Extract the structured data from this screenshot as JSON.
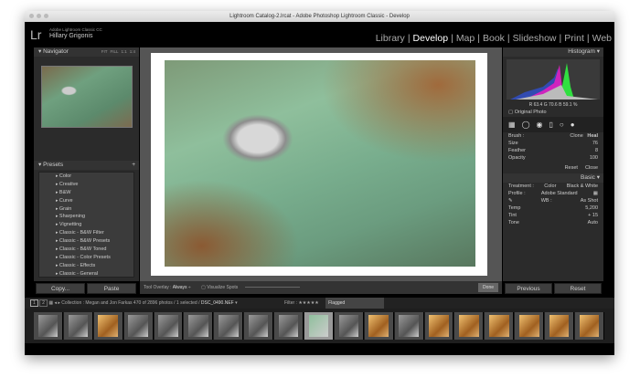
{
  "window": {
    "title": "Lightroom Catalog-2.lrcat - Adobe Photoshop Lightroom Classic - Develop"
  },
  "identity": {
    "logo": "Lr",
    "app": "Adobe Lightroom Classic CC",
    "user": "Hillary Grigonis"
  },
  "modules": [
    "Library",
    "Develop",
    "Map",
    "Book",
    "Slideshow",
    "Print",
    "Web"
  ],
  "active_module": "Develop",
  "navigator": {
    "title": "Navigator",
    "zoom": [
      "FIT",
      "FILL",
      "1:1",
      "1:4"
    ]
  },
  "presets": {
    "title": "Presets",
    "items": [
      "Color",
      "Creative",
      "B&W",
      "Curve",
      "Grain",
      "Sharpening",
      "Vignetting",
      "Classic - B&W Filter",
      "Classic - B&W Presets",
      "Classic - B&W Toned",
      "Classic - Color Presets",
      "Classic - Effects",
      "Classic - General"
    ]
  },
  "left_buttons": {
    "copy": "Copy...",
    "paste": "Paste"
  },
  "toolbar": {
    "tool_overlay_label": "Tool Overlay :",
    "tool_overlay_value": "Always",
    "visualize": "Visualize Spots",
    "done": "Done"
  },
  "histogram": {
    "title": "Histogram",
    "r": "63.4",
    "g": "70.6",
    "b": "59.1",
    "pct": "%",
    "original": "Original Photo"
  },
  "brush": {
    "label": "Brush :",
    "clone": "Clone",
    "heal": "Heal",
    "size_label": "Size",
    "size": "76",
    "feather_label": "Feather",
    "feather": "8",
    "opacity_label": "Opacity",
    "opacity": "100",
    "reset": "Reset",
    "close": "Close"
  },
  "basic": {
    "title": "Basic",
    "treatment": "Treatment :",
    "color": "Color",
    "bw": "Black & White",
    "profile": "Profile :",
    "profile_value": "Adobe Standard",
    "wb": "WB :",
    "wb_value": "As Shot",
    "temp": "Temp",
    "temp_value": "5,200",
    "tint": "Tint",
    "tint_value": "+ 15",
    "tone": "Tone",
    "auto": "Auto"
  },
  "right_buttons": {
    "previous": "Previous",
    "reset": "Reset"
  },
  "filmstrip": {
    "pages": [
      "1",
      "2"
    ],
    "collection": "Collection : Megan and Jon Farkas",
    "count": "470 of 2896 photos / 1 selected /",
    "file": "DSC_0490.NEF",
    "filter": "Filter :",
    "flag": "Flagged"
  }
}
